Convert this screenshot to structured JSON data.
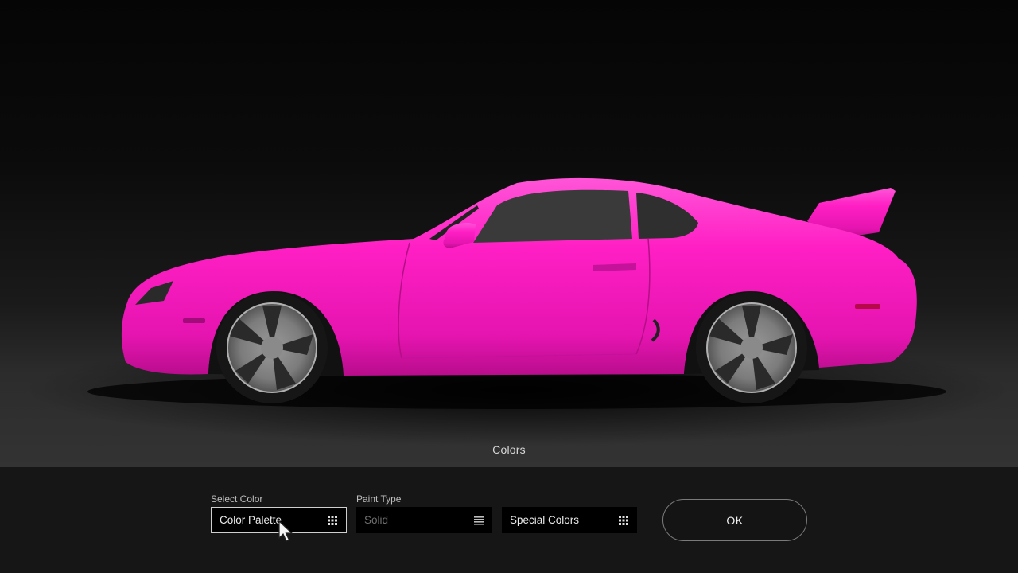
{
  "screen": {
    "title": "Colors"
  },
  "car": {
    "paint_color": "#ff1fc4"
  },
  "controls": {
    "select_color": {
      "label": "Select Color",
      "value": "Color Palette",
      "icon": "grid-icon"
    },
    "paint_type": {
      "label": "Paint Type",
      "value": "Solid",
      "icon": "list-icon"
    },
    "special_colors": {
      "value": "Special Colors",
      "icon": "grid-icon"
    },
    "ok": {
      "label": "OK"
    }
  }
}
